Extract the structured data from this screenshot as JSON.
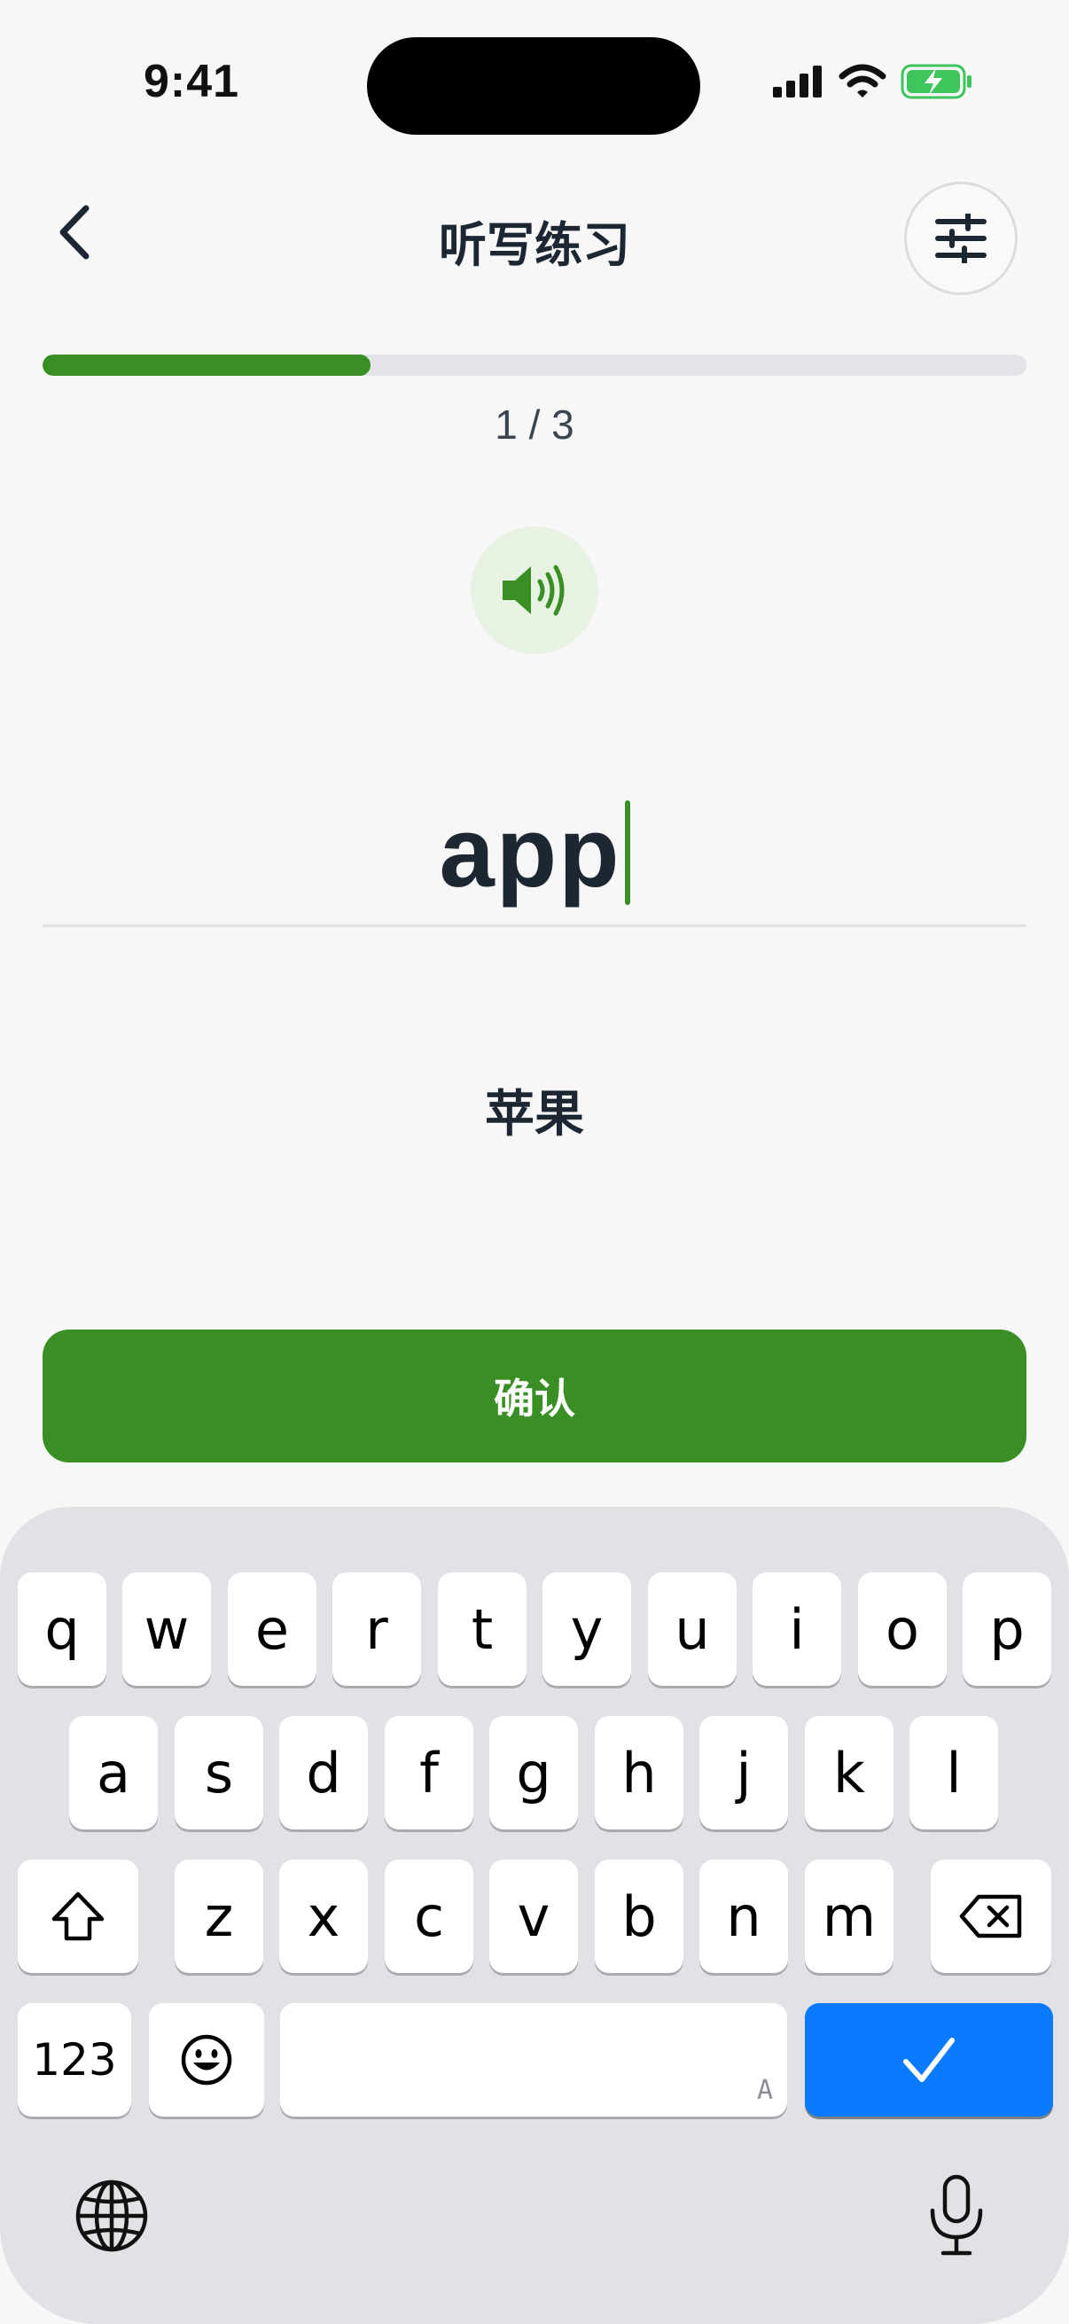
{
  "status_bar": {
    "time": "9:41"
  },
  "header": {
    "title": "听写练习",
    "back_icon": "chevron-left-icon",
    "settings_icon": "sliders-icon"
  },
  "progress": {
    "current": 1,
    "total": 3,
    "fraction": 0.333,
    "label": "1 / 3"
  },
  "speaker": {
    "icon": "speaker-icon"
  },
  "answer": {
    "value": "app"
  },
  "meaning": "苹果",
  "confirm_label": "确认",
  "keyboard": {
    "row1": [
      "q",
      "w",
      "e",
      "r",
      "t",
      "y",
      "u",
      "i",
      "o",
      "p"
    ],
    "row2": [
      "a",
      "s",
      "d",
      "f",
      "g",
      "h",
      "j",
      "k",
      "l"
    ],
    "row3": [
      "z",
      "x",
      "c",
      "v",
      "b",
      "n",
      "m"
    ],
    "numbers_label": "123",
    "space_mark": "A"
  },
  "colors": {
    "accent": "#3a8f24",
    "keyboard_done": "#0a7aff"
  }
}
